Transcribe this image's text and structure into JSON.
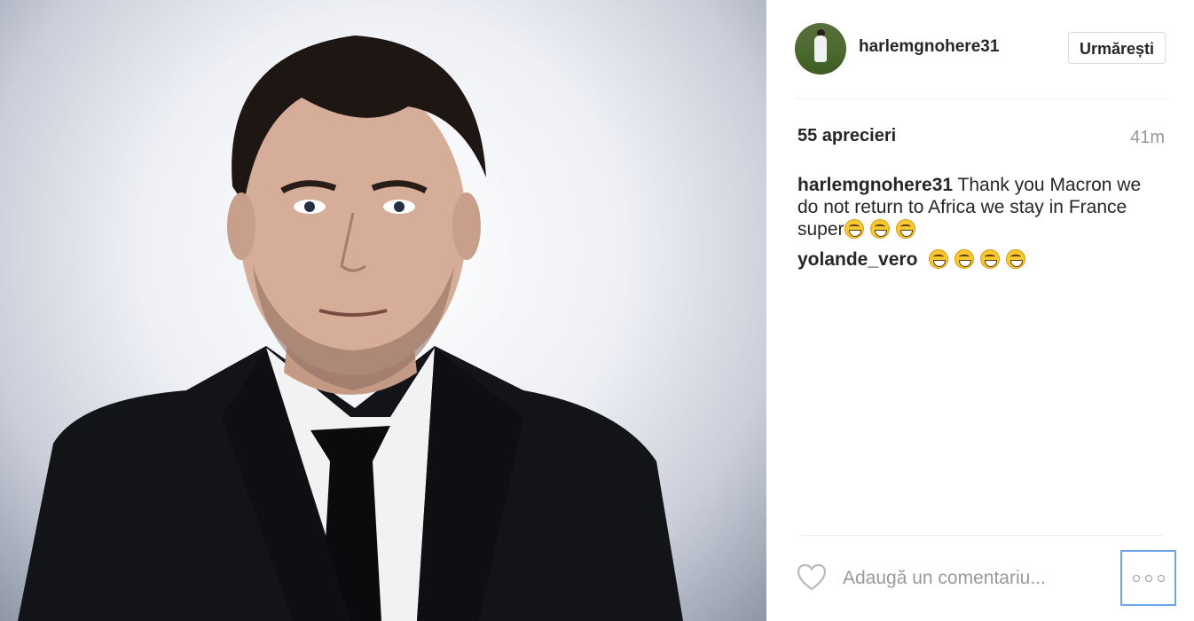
{
  "post": {
    "image_alt": "Portrait of a man in a dark suit and black tie"
  },
  "header": {
    "username": "harlemgnohere31",
    "follow_label": "Urmărești"
  },
  "stats": {
    "likes": "55 aprecieri",
    "time": "41m"
  },
  "comments": [
    {
      "user": "harlemgnohere31",
      "text": "Thank you Macron we do not return to Africa we stay in France super",
      "emoji_count": 3,
      "emoji": "face-with-tears-of-joy"
    },
    {
      "user": "yolande_vero",
      "text": "",
      "emoji_count": 4,
      "emoji": "face-with-tears-of-joy"
    }
  ],
  "footer": {
    "comment_placeholder": "Adaugă un comentariu...",
    "like_icon": "heart-outline-icon",
    "more_icon": "ellipsis-icon"
  },
  "colors": {
    "border": "#dbdbdb",
    "muted_text": "#999999",
    "focus_ring": "#6fa3e8"
  }
}
